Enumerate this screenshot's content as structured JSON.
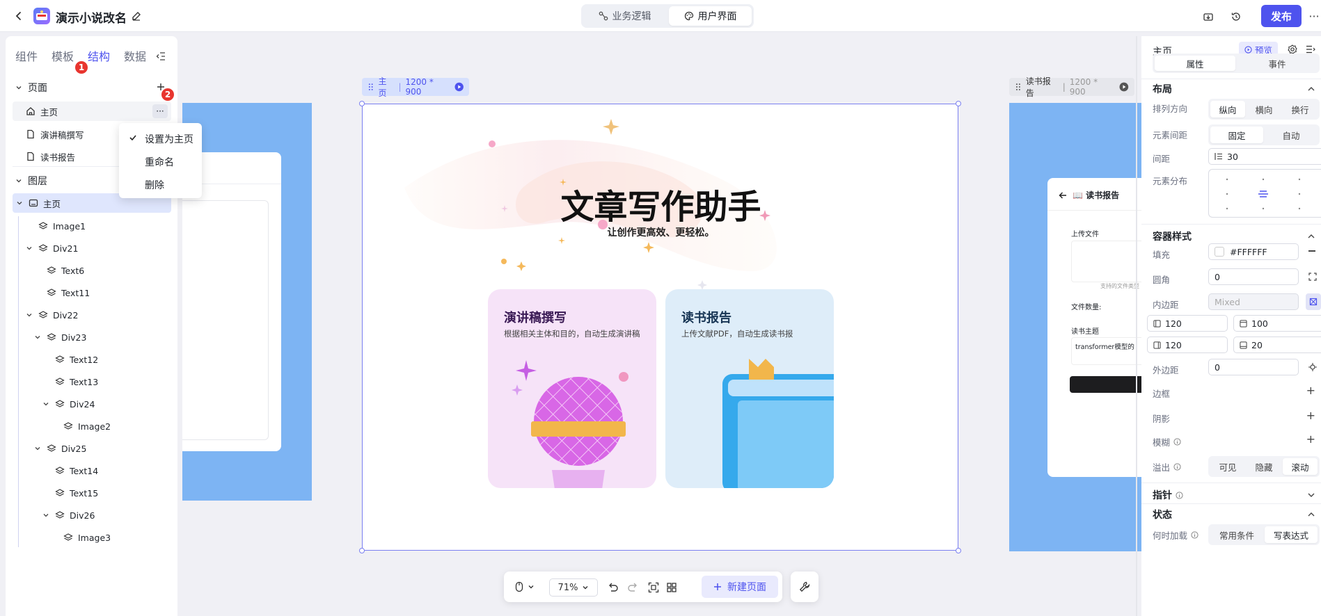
{
  "app": {
    "title": "演示小说改名"
  },
  "mode_tabs": [
    {
      "label": "业务逻辑"
    },
    {
      "label": "用户界面"
    }
  ],
  "header_actions": {
    "publish": "发布",
    "more": "···"
  },
  "left": {
    "tabs": [
      {
        "label": "组件"
      },
      {
        "label": "模板"
      },
      {
        "label": "结构"
      },
      {
        "label": "数据"
      }
    ],
    "badges": [
      "1",
      "2"
    ],
    "pages_title": "页面",
    "pages": [
      {
        "label": "主页"
      },
      {
        "label": "演讲稿撰写"
      },
      {
        "label": "读书报告"
      }
    ],
    "page_more": "···",
    "layers_title": "图层",
    "layers": [
      {
        "label": "主页"
      },
      {
        "label": "Image1"
      },
      {
        "label": "Div21"
      },
      {
        "label": "Text6"
      },
      {
        "label": "Text11"
      },
      {
        "label": "Div22"
      },
      {
        "label": "Div23"
      },
      {
        "label": "Text12"
      },
      {
        "label": "Text13"
      },
      {
        "label": "Div24"
      },
      {
        "label": "Image2"
      },
      {
        "label": "Div25"
      },
      {
        "label": "Text14"
      },
      {
        "label": "Text15"
      },
      {
        "label": "Div26"
      },
      {
        "label": "Image3"
      }
    ]
  },
  "context_menu": [
    {
      "label": "设置为主页"
    },
    {
      "label": "重命名"
    },
    {
      "label": "删除"
    }
  ],
  "canvas": {
    "main_tag": {
      "name": "主页",
      "size": "1200 * 900"
    },
    "right_tag": {
      "name": "读书报告",
      "size": "1200 * 900"
    },
    "hero_title": "文章写作助手",
    "hero_subtitle": "让创作更高效、更轻松。",
    "cards": [
      {
        "title": "演讲稿撰写",
        "desc": "根据相关主体和目的，自动生成演讲稿"
      },
      {
        "title": "读书报告",
        "desc": "上传文献PDF，自动生成读书报"
      }
    ],
    "report_preview": {
      "title": "📖 读书报告",
      "upload_label": "上传文件",
      "hint": "支持的文件类型",
      "count_label": "文件数量:",
      "topic_label": "读书主题",
      "topic_value": "transformer模型的"
    }
  },
  "bottom_toolbar": {
    "zoom": "71%",
    "new_page": "新建页面"
  },
  "right": {
    "page_name": "主页",
    "preview": "预览",
    "tabs": [
      {
        "label": "属性"
      },
      {
        "label": "事件"
      }
    ],
    "layout_title": "布局",
    "direction_label": "排列方向",
    "direction_options": [
      {
        "label": "纵向"
      },
      {
        "label": "横向"
      },
      {
        "label": "换行"
      }
    ],
    "spacing_label": "元素间距",
    "spacing_options": [
      {
        "label": "固定"
      },
      {
        "label": "自动"
      }
    ],
    "gap_label": "间距",
    "gap_value": "30",
    "distribution_label": "元素分布",
    "container_title": "容器样式",
    "fill_label": "填充",
    "fill_value": "#FFFFFF",
    "radius_label": "圆角",
    "radius_value": "0",
    "padding_label": "内边距",
    "padding_placeholder": "Mixed",
    "padding_values": [
      "120",
      "100",
      "120",
      "20"
    ],
    "margin_label": "外边距",
    "margin_value": "0",
    "border_label": "边框",
    "shadow_label": "阴影",
    "blur_label": "模糊",
    "overflow_label": "溢出",
    "overflow_options": [
      {
        "label": "可见"
      },
      {
        "label": "隐藏"
      },
      {
        "label": "滚动"
      }
    ],
    "pointer_title": "指针",
    "state_title": "状态",
    "load_label": "何时加载",
    "load_options": [
      {
        "label": "常用条件"
      },
      {
        "label": "写表达式"
      }
    ]
  },
  "colors": {
    "accent": "#4e53ee",
    "card_pink": "#f6e3f8",
    "card_blue": "#deedf9",
    "frame_blue": "#7db4f3",
    "badge_red": "#e8352f"
  }
}
